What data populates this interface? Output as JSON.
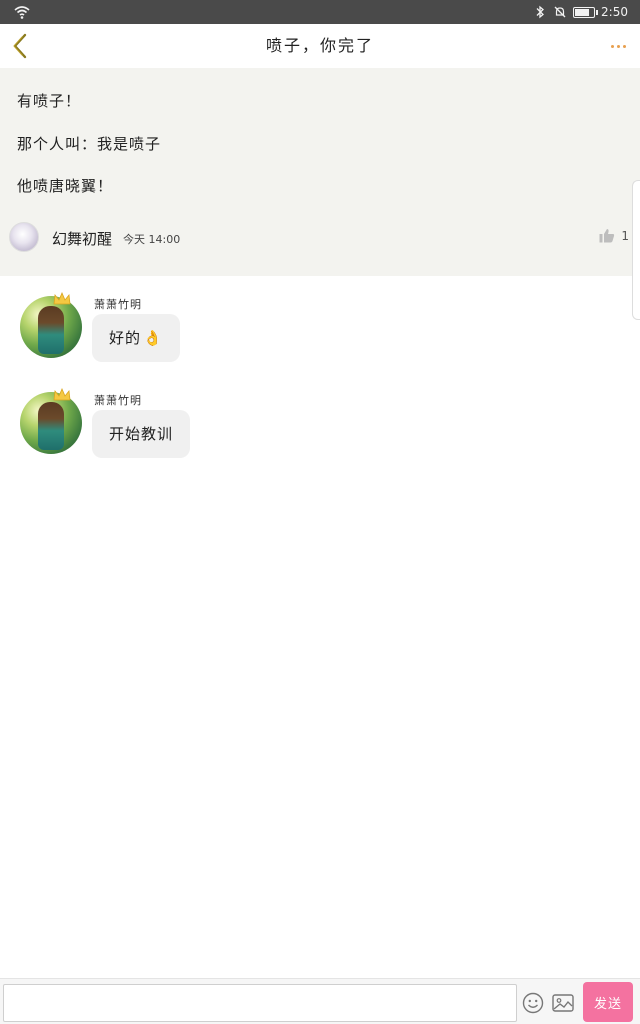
{
  "status_bar": {
    "time": "2:50",
    "battery_level": 0.85
  },
  "header": {
    "title": "喷子，你完了"
  },
  "post": {
    "lines": [
      "有喷子！",
      "那个人叫：我是喷子",
      "他喷唐晓翼！"
    ],
    "author": "幻舞初醒",
    "time": "今天 14:00",
    "like_count": "1"
  },
  "messages": [
    {
      "sender": "萧萧竹明",
      "text": "好的",
      "emoji": "👌"
    },
    {
      "sender": "萧萧竹明",
      "text": "开始教训"
    }
  ],
  "composer": {
    "input_value": "",
    "send_label": "发送"
  },
  "colors": {
    "accent": "#e8a04f",
    "send_button": "#f472a0",
    "post_background": "#f3f3ef",
    "status_bar": "#4a4a4a"
  },
  "icons": {
    "back": "chevron-left-icon",
    "more": "more-dots-icon",
    "like": "thumbs-up-icon",
    "emoji": "smiley-icon",
    "image": "image-icon"
  }
}
